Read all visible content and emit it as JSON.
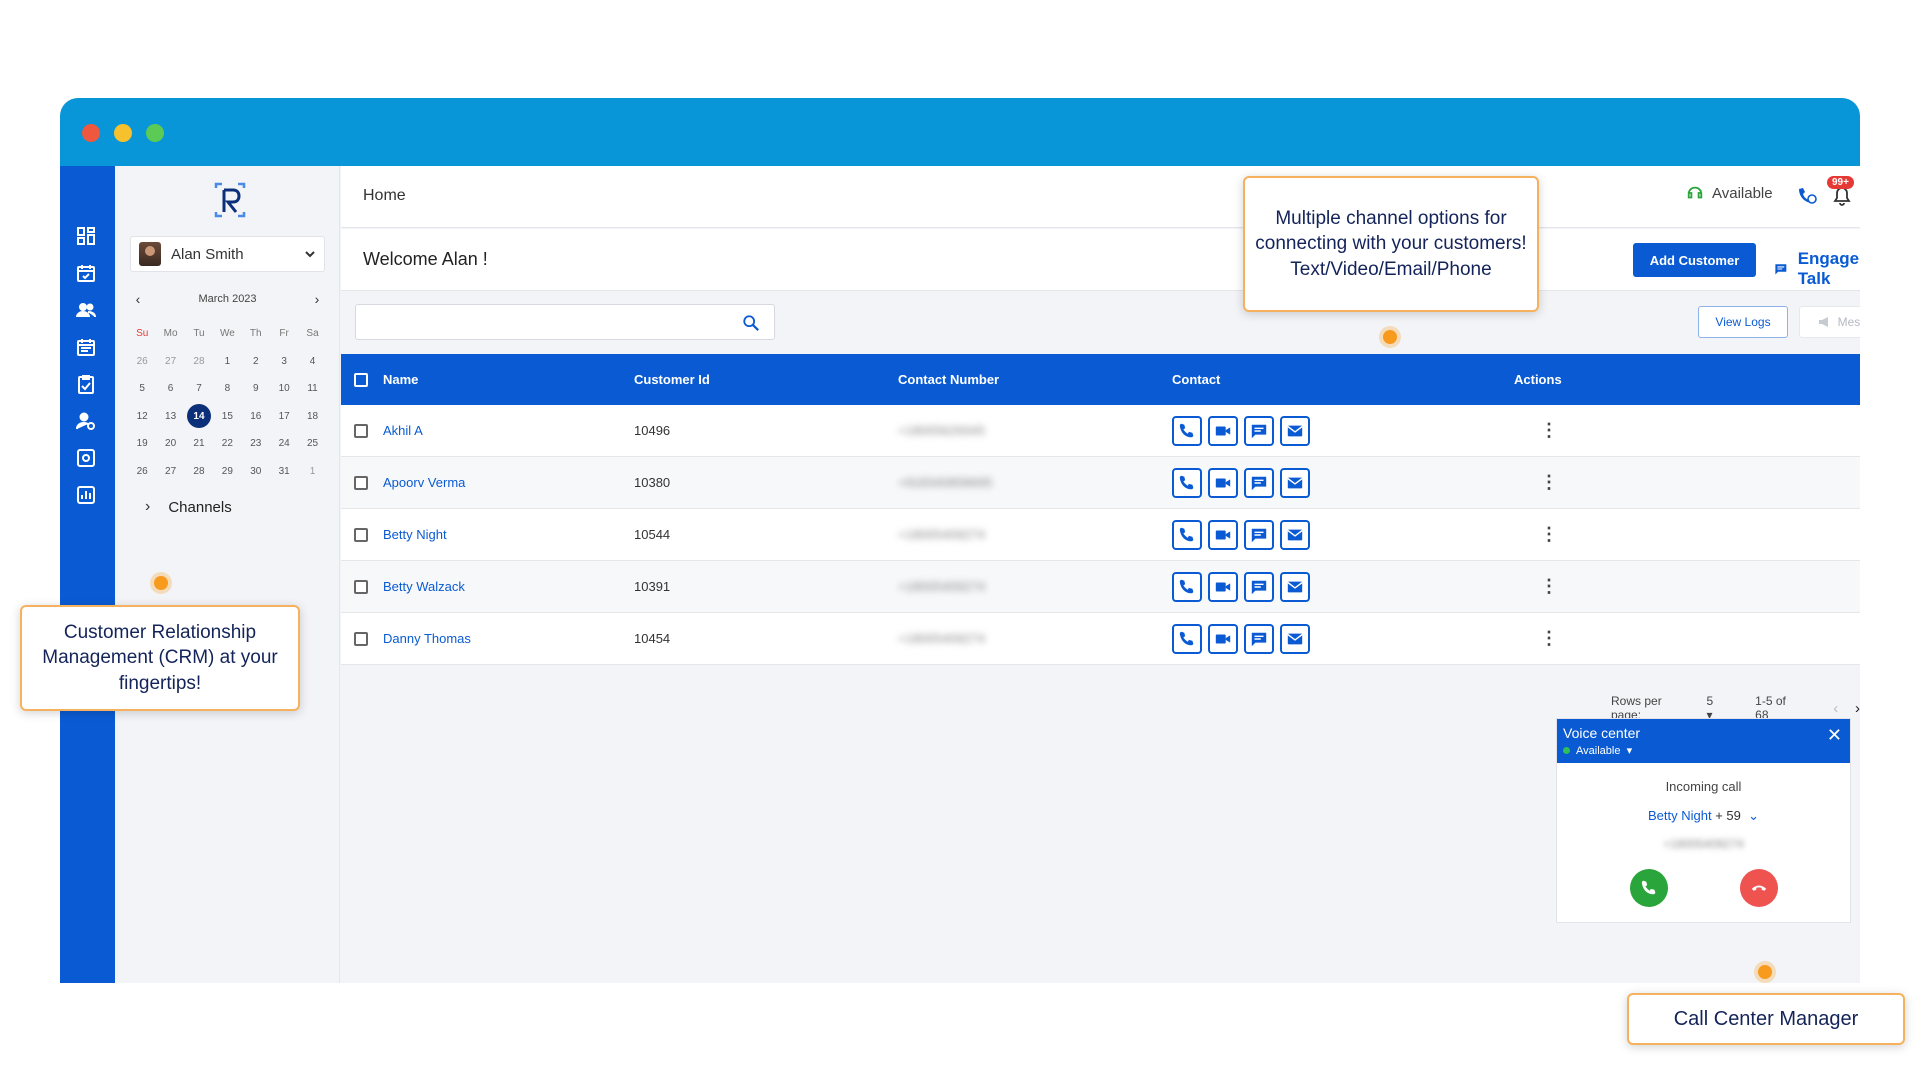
{
  "window": {
    "title": ""
  },
  "header": {
    "breadcrumb": "Home",
    "status_label": "Available",
    "notification_badge": "99+"
  },
  "sidebar_user": {
    "name": "Alan Smith"
  },
  "calendar": {
    "month_label": "March 2023",
    "weekdays": [
      "Su",
      "Mo",
      "Tu",
      "We",
      "Th",
      "Fr",
      "Sa"
    ],
    "weeks": [
      [
        "26",
        "27",
        "28",
        "1",
        "2",
        "3",
        "4"
      ],
      [
        "5",
        "6",
        "7",
        "8",
        "9",
        "10",
        "11"
      ],
      [
        "12",
        "13",
        "14",
        "15",
        "16",
        "17",
        "18"
      ],
      [
        "19",
        "20",
        "21",
        "22",
        "23",
        "24",
        "25"
      ],
      [
        "26",
        "27",
        "28",
        "29",
        "30",
        "31",
        "1"
      ]
    ],
    "selected_day": "14"
  },
  "nav": {
    "channels_label": "Channels"
  },
  "welcome": {
    "text": "Welcome Alan !",
    "add_customer_label": "Add Customer",
    "engage_label": "Engage Talk"
  },
  "search": {
    "placeholder": "",
    "value": ""
  },
  "toolbar": {
    "view_logs_label": "View Logs",
    "message_label": "Message"
  },
  "table": {
    "columns": [
      "Name",
      "Customer Id",
      "Contact Number",
      "Contact",
      "Actions"
    ],
    "rows": [
      {
        "name": "Akhil A",
        "customer_id": "10496",
        "contact_number": "+18005629345"
      },
      {
        "name": "Apoorv Verma",
        "customer_id": "10380",
        "contact_number": "+918340858695"
      },
      {
        "name": "Betty Night",
        "customer_id": "10544",
        "contact_number": "+18005409274"
      },
      {
        "name": "Betty Walzack",
        "customer_id": "10391",
        "contact_number": "+18005409274"
      },
      {
        "name": "Danny Thomas",
        "customer_id": "10454",
        "contact_number": "+18005409274"
      }
    ]
  },
  "pagination": {
    "rows_per_page_label": "Rows per page:",
    "rows_per_page_value": "5",
    "range_label": "1-5 of 68"
  },
  "voice_center": {
    "title": "Voice center",
    "status": "Available",
    "incoming_label": "Incoming call",
    "caller_name": "Betty Night",
    "caller_extra": "+ 59",
    "caller_number": "+18005409274"
  },
  "callouts": {
    "channels": "Multiple channel options for connecting with your customers! Text/Video/Email/Phone",
    "crm": "Customer Relationship Management (CRM) at your fingertips!",
    "call_center": "Call Center Manager"
  },
  "colors": {
    "titlebar": "#0996d9",
    "rail": "#0a5bd3",
    "accent": "#0a5bd3",
    "callout_border": "#f6b15e",
    "marker": "#f79a1e",
    "accept": "#2aa53b",
    "reject": "#ef5350"
  },
  "icons": {
    "rail": [
      "dashboard-icon",
      "calendar-check-icon",
      "people-icon",
      "calendar-icon",
      "clipboard-check-icon",
      "user-settings-icon",
      "settings-box-icon",
      "chart-icon"
    ],
    "contact": [
      "phone-icon",
      "video-icon",
      "chat-icon",
      "email-icon"
    ]
  }
}
